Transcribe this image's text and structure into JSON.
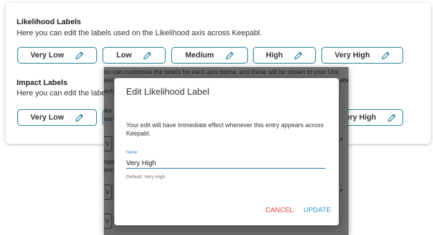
{
  "likelihood": {
    "title": "Likelihood Labels",
    "description": "Here you can edit the labels used on the Likelihood axis across Keepabl.",
    "chips": [
      {
        "label": "Very Low",
        "icon": "pencil-icon"
      },
      {
        "label": "Low",
        "icon": "pencil-icon"
      },
      {
        "label": "Medium",
        "icon": "pencil-icon"
      },
      {
        "label": "High",
        "icon": "pencil-icon"
      },
      {
        "label": "Very High",
        "icon": "pencil-icon"
      }
    ]
  },
  "impact": {
    "title": "Impact Labels",
    "description": "Here you can edit the labe",
    "chips": [
      {
        "label": "Very Low",
        "icon": "pencil-icon"
      },
      {
        "label": "Very High",
        "icon": "pencil-icon"
      }
    ]
  },
  "background_fragment": {
    "line1": "ou can customise the labels for each axis below, and these will be shown to your Use",
    "k1": "keli",
    "k2": "ech",
    "k3": "ike",
    "k4": "ere",
    "k5": "npa",
    "k6": "ere",
    "abe": "abe",
    "v1": "V",
    "v2": "V",
    "v3": "V",
    "caret": "↗"
  },
  "dialog": {
    "title": "Edit Likelihood Label",
    "body": "Your edit will have immediate effect whenever this entry appears across Keepabl.",
    "field_label": "Name",
    "field_value": "Very High",
    "helper": "Default: Very High",
    "cancel": "CANCEL",
    "update": "UPDATE"
  },
  "colors": {
    "chip_border": "#1f7e93",
    "pencil": "#1f7e93",
    "cancel": "#e0483e",
    "update": "#3a9bd9",
    "accent": "#2b74c7"
  }
}
